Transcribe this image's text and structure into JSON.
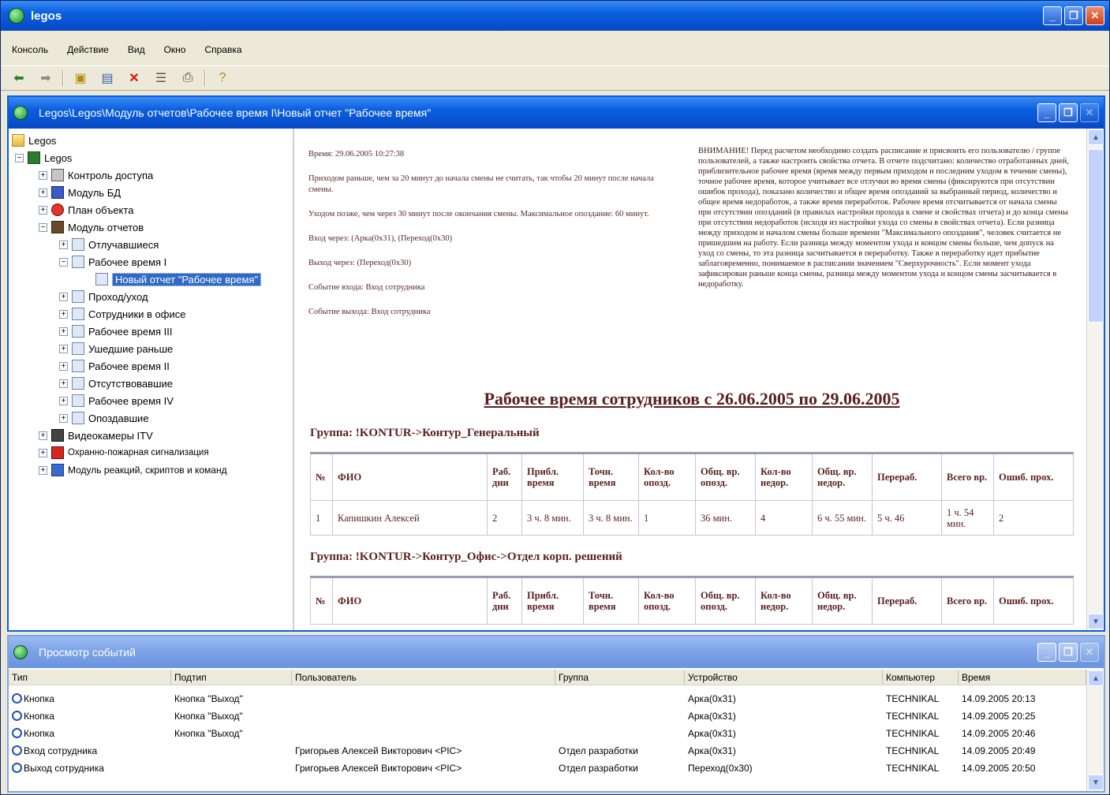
{
  "app": {
    "title": "legos"
  },
  "menu": [
    "Консоль",
    "Действие",
    "Вид",
    "Окно",
    "Справка"
  ],
  "child_window": {
    "title": "Legos\\Legos\\Модуль отчетов\\Рабочее время I\\Новый отчет \"Рабочее время\""
  },
  "tree": {
    "root": "Legos",
    "module_root": "Legos",
    "items": [
      {
        "label": "Контроль доступа",
        "icon": "lock-icon"
      },
      {
        "label": "Модуль БД",
        "icon": "database-icon"
      },
      {
        "label": "План объекта",
        "icon": "plan-icon"
      },
      {
        "label": "Модуль отчетов",
        "icon": "report-module-icon"
      }
    ],
    "reports": [
      "Отлучавшиеся",
      "Рабочее время I",
      "Проход/уход",
      "Сотрудники в офисе",
      "Рабочее время III",
      "Ушедшие раньше",
      "Рабочее время II",
      "Отсутствовавшие",
      "Рабочее время IV",
      "Опоздавшие"
    ],
    "selected": "Новый отчет \"Рабочее время\"",
    "tail": [
      {
        "label": "Видеокамеры ITV",
        "icon": "camera-icon"
      },
      {
        "label": "Охранно-пожарная сигнализация",
        "icon": "fire-alarm-icon"
      },
      {
        "label": "Модуль реакций, скриптов и команд",
        "icon": "script-icon"
      }
    ]
  },
  "report": {
    "time_line": "Время: 29.06.2005 10:27:38",
    "arrival_rule": "Приходом раньше, чем за 20 минут до начала смены не считать, так чтобы 20 минут после начала смены.",
    "leave_rule": "Уходом позже, чем через 30 минут после окончания смены. Максимальное опоздание: 60 минут.",
    "entry_via": "Вход через: (Арка(0х31), (Переход(0х30)",
    "exit_via": "Выход через: (Переход(0х30)",
    "event_entry": "Событие входа: Вход сотрудника",
    "event_exit": "Событие выхода: Вход сотрудника",
    "note": "ВНИМАНИЕ! Перед расчетом необходимо создать расписание и присвоить его пользователю / группе пользователей, а также настроить свойства отчета. В отчете подсчитано: количество отработанных дней, приблизительное рабочее время (время между первым приходом и последним уходом в течение смены), точное рабочее время, которое учитывает все отлучки во время смены (фиксируются при отсутствии ошибок прохода), показано количество и общее время опозданий за выбранный период, количество и общее время недоработок, а также время переработок. Рабочее время отсчитывается от начала смены при отсутствии опозданий (в правилах настройки прохода к смене и свойствах отчета) и до конца смены при отсутствии недоработок (исходя из настройки ухода со смены в свойствах отчета). Если разница между приходом и началом смены больше времени \"Максимального опоздания\", человек считается не пришедшим на работу. Если разница между моментом ухода и концом смены больше, чем допуск на уход со смены, то эта разница засчитывается в переработку. Также в переработку идет прибытие заблаговременно, понимаемое в расписании значением \"Сверхурочность\". Если момент ухода зафиксирован раньше конца смены, разница между моментом ухода и концом смены засчитывается в недоработку.",
    "title": "Рабочее время сотрудников с 26.06.2005 по 29.06.2005",
    "group1": "Группа: !KONTUR->Контур_Генеральный",
    "group2": "Группа: !KONTUR->Контур_Офис->Отдел корп. решений",
    "columns": [
      "№",
      "ФИО",
      "Раб. дни",
      "Прибл. время",
      "Точн. время",
      "Кол-во опозд.",
      "Общ. вр. опозд.",
      "Кол-во недор.",
      "Общ. вр. недор.",
      "Перераб.",
      "Всего вр.",
      "Ошиб. прох."
    ],
    "rows1": [
      [
        "1",
        "Капишкин Алексей",
        "2",
        "3 ч. 8 мин.",
        "3 ч. 8 мин.",
        "1",
        "36 мин.",
        "4",
        "6 ч. 55 мин.",
        "5 ч. 46",
        "1 ч. 54 мин.",
        "2"
      ]
    ]
  },
  "events": {
    "title": "Просмотр событий",
    "columns": [
      "Тип",
      "Подтип",
      "Пользователь",
      "Группа",
      "Устройство",
      "Компьютер",
      "Время"
    ],
    "rows": [
      [
        "Кнопка",
        "Кнопка \"Выход\"",
        "",
        "",
        "Арка(0х31)",
        "TECHNIKAL",
        "14.09.2005 20:13"
      ],
      [
        "Кнопка",
        "Кнопка \"Выход\"",
        "",
        "",
        "Арка(0х31)",
        "TECHNIKAL",
        "14.09.2005 20:25"
      ],
      [
        "Кнопка",
        "Кнопка \"Выход\"",
        "",
        "",
        "Арка(0х31)",
        "TECHNIKAL",
        "14.09.2005 20:46"
      ],
      [
        "Вход сотрудника",
        "",
        "Григорьев Алексей Викторович <PIC>",
        "Отдел разработки",
        "Арка(0х31)",
        "TECHNIKAL",
        "14.09.2005 20:49"
      ],
      [
        "Выход сотрудника",
        "",
        "Григорьев Алексей Викторович <PIC>",
        "Отдел разработки",
        "Переход(0х30)",
        "TECHNIKAL",
        "14.09.2005 20:50"
      ]
    ]
  }
}
